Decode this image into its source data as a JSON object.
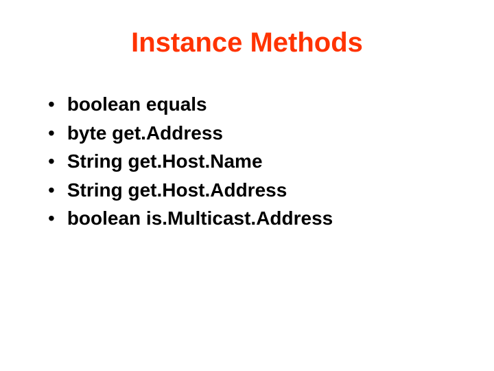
{
  "slide": {
    "title": "Instance Methods",
    "bullets": [
      "boolean equals",
      "byte get.Address",
      "String get.Host.Name",
      "String get.Host.Address",
      "boolean is.Multicast.Address"
    ]
  }
}
